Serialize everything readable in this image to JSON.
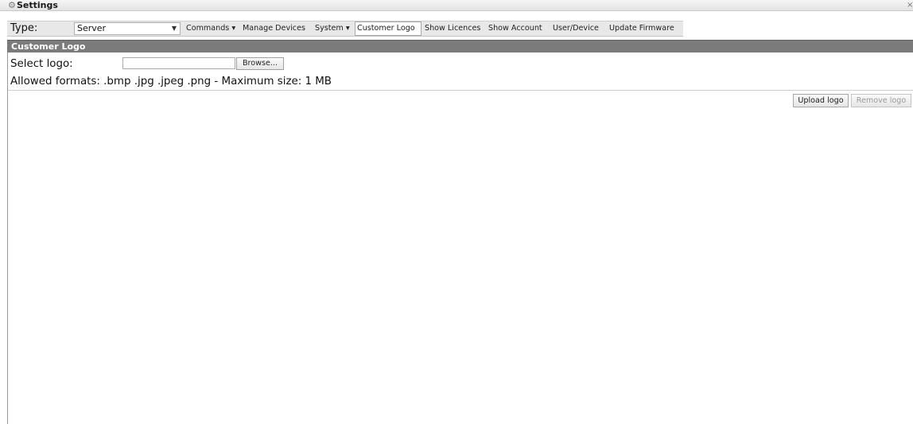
{
  "window": {
    "title": "Settings",
    "title_icon": "gear-icon",
    "close_icon": "close-icon"
  },
  "toolbar": {
    "type_label": "Type:",
    "type_value": "Server",
    "dropdown_icon": "chevron-down-icon",
    "items": [
      {
        "label": "Commands ▾"
      },
      {
        "label": "Manage Devices"
      },
      {
        "label": "System ▾"
      },
      {
        "label": "Customer Logo",
        "active": true
      },
      {
        "label": "Show Licences"
      },
      {
        "label": "Show Account"
      },
      {
        "label": "User/Device"
      },
      {
        "label": "Update Firmware"
      }
    ]
  },
  "panel": {
    "title": "Customer Logo",
    "select_logo_label": "Select logo:",
    "file_input_value": "",
    "browse_label": "Browse...",
    "allowed_formats": "Allowed formats: .bmp .jpg .jpeg .png - Maximum size: 1 MB",
    "upload_label": "Upload logo",
    "remove_label": "Remove logo"
  },
  "colors": {
    "panel_header_bg": "#7b7b7b",
    "toolbar_bg": "#e8e8e8",
    "disabled_text": "#9a9a9a"
  }
}
